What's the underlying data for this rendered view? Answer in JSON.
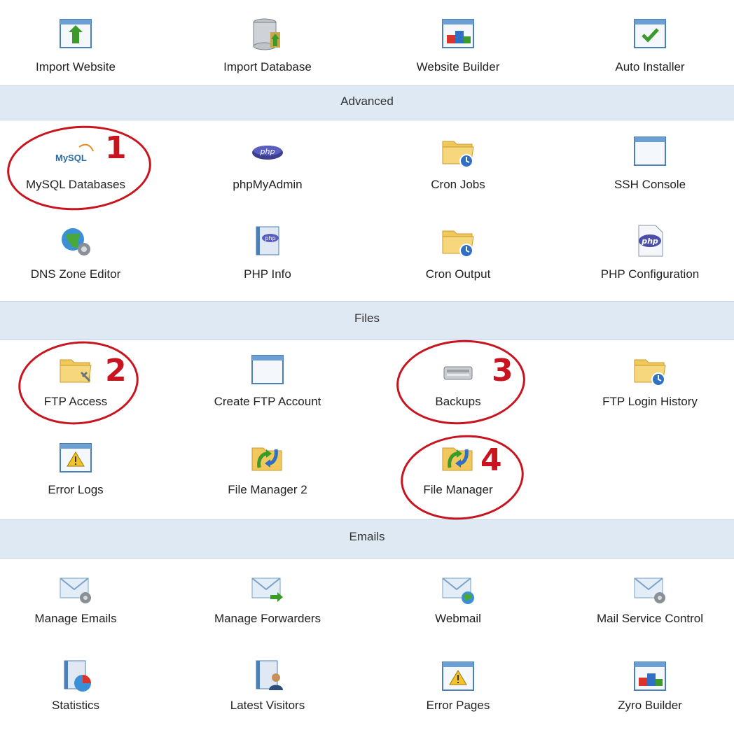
{
  "top_row": [
    {
      "label": "Import Website",
      "icon": "import-website-icon"
    },
    {
      "label": "Import Database",
      "icon": "import-database-icon"
    },
    {
      "label": "Website Builder",
      "icon": "website-builder-icon"
    },
    {
      "label": "Auto Installer",
      "icon": "auto-installer-icon"
    }
  ],
  "sections": {
    "advanced": {
      "title": "Advanced",
      "items": [
        {
          "label": "MySQL Databases",
          "icon": "mysql-icon"
        },
        {
          "label": "phpMyAdmin",
          "icon": "phpmyadmin-icon"
        },
        {
          "label": "Cron Jobs",
          "icon": "cron-folder-icon"
        },
        {
          "label": "SSH Console",
          "icon": "ssh-window-icon"
        },
        {
          "label": "DNS Zone Editor",
          "icon": "dns-globe-icon"
        },
        {
          "label": "PHP Info",
          "icon": "php-info-icon"
        },
        {
          "label": "Cron Output",
          "icon": "cron-output-folder-icon"
        },
        {
          "label": "PHP Configuration",
          "icon": "php-config-icon"
        }
      ]
    },
    "files": {
      "title": "Files",
      "items": [
        {
          "label": "FTP Access",
          "icon": "ftp-folder-icon"
        },
        {
          "label": "Create FTP Account",
          "icon": "create-ftp-window-icon"
        },
        {
          "label": "Backups",
          "icon": "backup-drive-icon"
        },
        {
          "label": "FTP Login History",
          "icon": "ftp-history-folder-icon"
        },
        {
          "label": "Error Logs",
          "icon": "error-logs-icon"
        },
        {
          "label": "File Manager 2",
          "icon": "file-manager-2-icon"
        },
        {
          "label": "File Manager",
          "icon": "file-manager-icon"
        }
      ]
    },
    "emails": {
      "title": "Emails",
      "items": [
        {
          "label": "Manage Emails",
          "icon": "manage-emails-icon"
        },
        {
          "label": "Manage Forwarders",
          "icon": "forwarders-icon"
        },
        {
          "label": "Webmail",
          "icon": "webmail-icon"
        },
        {
          "label": "Mail Service Control",
          "icon": "mail-service-icon"
        },
        {
          "label": "Statistics",
          "icon": "statistics-icon"
        },
        {
          "label": "Latest Visitors",
          "icon": "latest-visitors-icon"
        },
        {
          "label": "Error Pages",
          "icon": "error-pages-icon"
        },
        {
          "label": "Zyro Builder",
          "icon": "zyro-builder-icon"
        }
      ]
    }
  },
  "annotations": [
    "1",
    "2",
    "3",
    "4"
  ],
  "mysql_logo_text": "MySQL",
  "colors": {
    "annotation": "#c8141e",
    "header_bg": "#dfe9f4"
  }
}
